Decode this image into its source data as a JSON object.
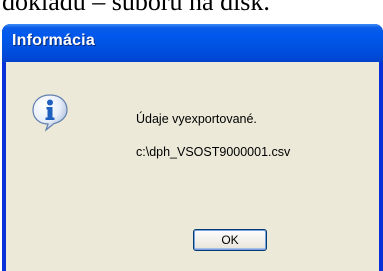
{
  "background": {
    "caption": "dokladu – súboru na disk."
  },
  "dialog": {
    "title": "Informácia",
    "icon": "info-icon",
    "message_line1": "Údaje vyexportované.",
    "message_line2": "c:\\dph_VSOST9000001.csv",
    "ok_label": "OK"
  },
  "colors": {
    "titlebar": "#0054e3",
    "client": "#ece9d8",
    "button_border": "#003c74"
  }
}
